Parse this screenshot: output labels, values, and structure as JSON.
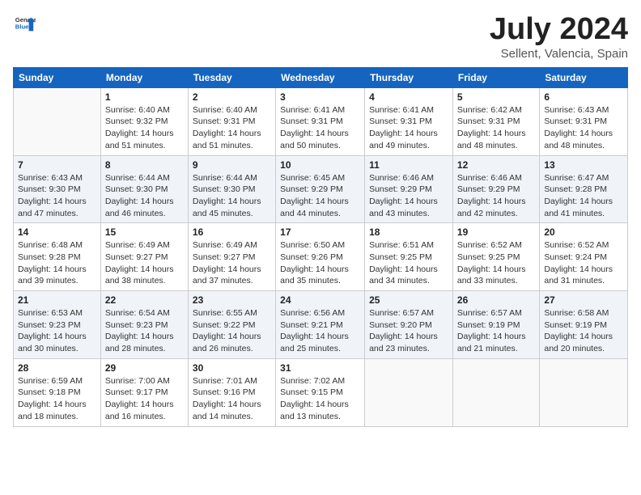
{
  "header": {
    "logo_general": "General",
    "logo_blue": "Blue",
    "month_year": "July 2024",
    "location": "Sellent, Valencia, Spain"
  },
  "weekdays": [
    "Sunday",
    "Monday",
    "Tuesday",
    "Wednesday",
    "Thursday",
    "Friday",
    "Saturday"
  ],
  "weeks": [
    [
      {
        "day": "",
        "info": ""
      },
      {
        "day": "1",
        "info": "Sunrise: 6:40 AM\nSunset: 9:32 PM\nDaylight: 14 hours\nand 51 minutes."
      },
      {
        "day": "2",
        "info": "Sunrise: 6:40 AM\nSunset: 9:31 PM\nDaylight: 14 hours\nand 51 minutes."
      },
      {
        "day": "3",
        "info": "Sunrise: 6:41 AM\nSunset: 9:31 PM\nDaylight: 14 hours\nand 50 minutes."
      },
      {
        "day": "4",
        "info": "Sunrise: 6:41 AM\nSunset: 9:31 PM\nDaylight: 14 hours\nand 49 minutes."
      },
      {
        "day": "5",
        "info": "Sunrise: 6:42 AM\nSunset: 9:31 PM\nDaylight: 14 hours\nand 48 minutes."
      },
      {
        "day": "6",
        "info": "Sunrise: 6:43 AM\nSunset: 9:31 PM\nDaylight: 14 hours\nand 48 minutes."
      }
    ],
    [
      {
        "day": "7",
        "info": "Sunrise: 6:43 AM\nSunset: 9:30 PM\nDaylight: 14 hours\nand 47 minutes."
      },
      {
        "day": "8",
        "info": "Sunrise: 6:44 AM\nSunset: 9:30 PM\nDaylight: 14 hours\nand 46 minutes."
      },
      {
        "day": "9",
        "info": "Sunrise: 6:44 AM\nSunset: 9:30 PM\nDaylight: 14 hours\nand 45 minutes."
      },
      {
        "day": "10",
        "info": "Sunrise: 6:45 AM\nSunset: 9:29 PM\nDaylight: 14 hours\nand 44 minutes."
      },
      {
        "day": "11",
        "info": "Sunrise: 6:46 AM\nSunset: 9:29 PM\nDaylight: 14 hours\nand 43 minutes."
      },
      {
        "day": "12",
        "info": "Sunrise: 6:46 AM\nSunset: 9:29 PM\nDaylight: 14 hours\nand 42 minutes."
      },
      {
        "day": "13",
        "info": "Sunrise: 6:47 AM\nSunset: 9:28 PM\nDaylight: 14 hours\nand 41 minutes."
      }
    ],
    [
      {
        "day": "14",
        "info": "Sunrise: 6:48 AM\nSunset: 9:28 PM\nDaylight: 14 hours\nand 39 minutes."
      },
      {
        "day": "15",
        "info": "Sunrise: 6:49 AM\nSunset: 9:27 PM\nDaylight: 14 hours\nand 38 minutes."
      },
      {
        "day": "16",
        "info": "Sunrise: 6:49 AM\nSunset: 9:27 PM\nDaylight: 14 hours\nand 37 minutes."
      },
      {
        "day": "17",
        "info": "Sunrise: 6:50 AM\nSunset: 9:26 PM\nDaylight: 14 hours\nand 35 minutes."
      },
      {
        "day": "18",
        "info": "Sunrise: 6:51 AM\nSunset: 9:25 PM\nDaylight: 14 hours\nand 34 minutes."
      },
      {
        "day": "19",
        "info": "Sunrise: 6:52 AM\nSunset: 9:25 PM\nDaylight: 14 hours\nand 33 minutes."
      },
      {
        "day": "20",
        "info": "Sunrise: 6:52 AM\nSunset: 9:24 PM\nDaylight: 14 hours\nand 31 minutes."
      }
    ],
    [
      {
        "day": "21",
        "info": "Sunrise: 6:53 AM\nSunset: 9:23 PM\nDaylight: 14 hours\nand 30 minutes."
      },
      {
        "day": "22",
        "info": "Sunrise: 6:54 AM\nSunset: 9:23 PM\nDaylight: 14 hours\nand 28 minutes."
      },
      {
        "day": "23",
        "info": "Sunrise: 6:55 AM\nSunset: 9:22 PM\nDaylight: 14 hours\nand 26 minutes."
      },
      {
        "day": "24",
        "info": "Sunrise: 6:56 AM\nSunset: 9:21 PM\nDaylight: 14 hours\nand 25 minutes."
      },
      {
        "day": "25",
        "info": "Sunrise: 6:57 AM\nSunset: 9:20 PM\nDaylight: 14 hours\nand 23 minutes."
      },
      {
        "day": "26",
        "info": "Sunrise: 6:57 AM\nSunset: 9:19 PM\nDaylight: 14 hours\nand 21 minutes."
      },
      {
        "day": "27",
        "info": "Sunrise: 6:58 AM\nSunset: 9:19 PM\nDaylight: 14 hours\nand 20 minutes."
      }
    ],
    [
      {
        "day": "28",
        "info": "Sunrise: 6:59 AM\nSunset: 9:18 PM\nDaylight: 14 hours\nand 18 minutes."
      },
      {
        "day": "29",
        "info": "Sunrise: 7:00 AM\nSunset: 9:17 PM\nDaylight: 14 hours\nand 16 minutes."
      },
      {
        "day": "30",
        "info": "Sunrise: 7:01 AM\nSunset: 9:16 PM\nDaylight: 14 hours\nand 14 minutes."
      },
      {
        "day": "31",
        "info": "Sunrise: 7:02 AM\nSunset: 9:15 PM\nDaylight: 14 hours\nand 13 minutes."
      },
      {
        "day": "",
        "info": ""
      },
      {
        "day": "",
        "info": ""
      },
      {
        "day": "",
        "info": ""
      }
    ]
  ]
}
